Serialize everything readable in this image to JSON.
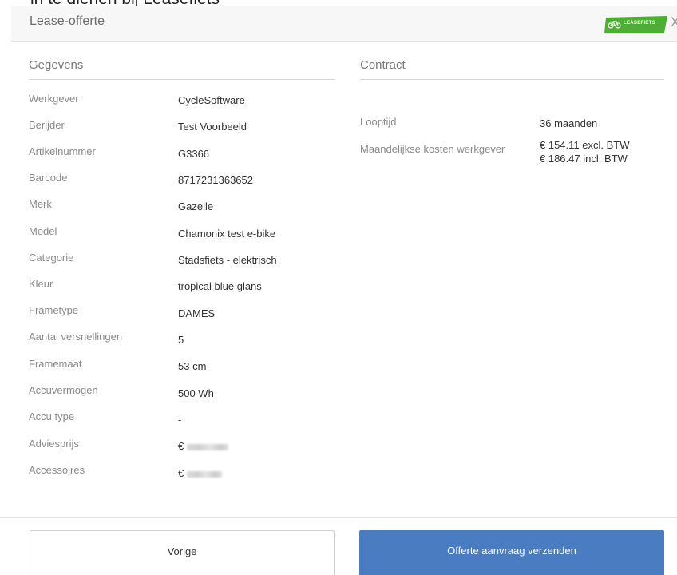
{
  "page_top_text": "in te dienen bij Leasefiets",
  "header": {
    "title": "Lease-offerte",
    "logo_text": "LEASEFIETS",
    "brand_color": "#4caf32",
    "close_glyph": "X"
  },
  "gegevens": {
    "title": "Gegevens",
    "rows": [
      {
        "label": "Werkgever",
        "value": "CycleSoftware"
      },
      {
        "label": "Berijder",
        "value": "Test Voorbeeld"
      },
      {
        "label": "Artikelnummer",
        "value": "G3366"
      },
      {
        "label": "Barcode",
        "value": "8717231363652"
      },
      {
        "label": "Merk",
        "value": "Gazelle"
      },
      {
        "label": "Model",
        "value": "Chamonix test e-bike"
      },
      {
        "label": "Categorie",
        "value": "Stadsfiets - elektrisch"
      },
      {
        "label": "Kleur",
        "value": "tropical blue glans"
      },
      {
        "label": "Frametype",
        "value": "DAMES"
      },
      {
        "label": "Aantal versnellingen",
        "value": "5"
      },
      {
        "label": "Framemaat",
        "value": "53 cm"
      },
      {
        "label": "Accuvermogen",
        "value": "500 Wh"
      },
      {
        "label": "Accu type",
        "value": "-"
      },
      {
        "label": "Adviesprijs",
        "value": "€"
      },
      {
        "label": "Accessoires",
        "value": "€"
      }
    ]
  },
  "contract": {
    "title": "Contract",
    "looptijd_label": "Looptijd",
    "looptijd_value": "36 maanden",
    "kosten_label": "Maandelijkse kosten werkgever",
    "kosten_excl": "€ 154.11 excl. BTW",
    "kosten_incl": "€ 186.47 incl. BTW"
  },
  "footer": {
    "prev_label": "Vorige",
    "send_label": "Offerte aanvraag verzenden",
    "send_color": "#4a7cc2"
  }
}
